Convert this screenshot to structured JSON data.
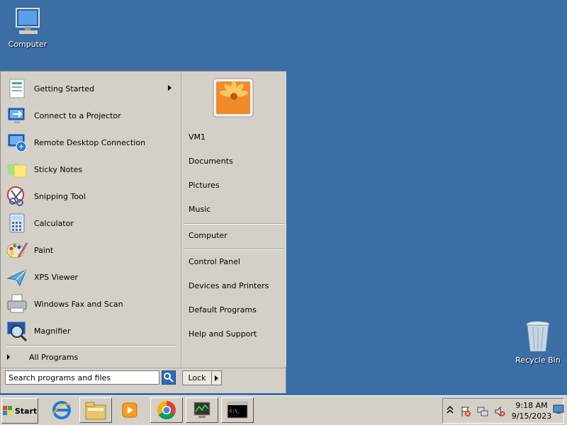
{
  "desktop": {
    "icons": [
      {
        "label": "Computer",
        "icon": "computer-icon"
      },
      {
        "label": "Recycle Bin",
        "icon": "recycle-bin-icon"
      }
    ]
  },
  "start_menu": {
    "programs": [
      {
        "label": "Getting Started",
        "icon": "getting-started-icon",
        "has_submenu": true
      },
      {
        "label": "Connect to a Projector",
        "icon": "projector-icon"
      },
      {
        "label": "Remote Desktop Connection",
        "icon": "remote-desktop-icon"
      },
      {
        "label": "Sticky Notes",
        "icon": "sticky-notes-icon"
      },
      {
        "label": "Snipping Tool",
        "icon": "snipping-tool-icon"
      },
      {
        "label": "Calculator",
        "icon": "calculator-icon"
      },
      {
        "label": "Paint",
        "icon": "paint-icon"
      },
      {
        "label": "XPS Viewer",
        "icon": "xps-viewer-icon"
      },
      {
        "label": "Windows Fax and Scan",
        "icon": "fax-scan-icon"
      },
      {
        "label": "Magnifier",
        "icon": "magnifier-icon"
      }
    ],
    "all_programs": "All Programs",
    "right_items": {
      "user": "VM1",
      "documents": "Documents",
      "pictures": "Pictures",
      "music": "Music",
      "computer": "Computer",
      "control_panel": "Control Panel",
      "devices": "Devices and Printers",
      "default_programs": "Default Programs",
      "help": "Help and Support"
    },
    "search_placeholder": "Search programs and files",
    "lock_label": "Lock"
  },
  "taskbar": {
    "start_label": "Start",
    "pinned": [
      "internet-explorer-icon",
      "file-explorer-icon",
      "media-player-icon",
      "chrome-icon",
      "task-manager-icon",
      "command-prompt-icon"
    ],
    "clock_time": "9:18 AM",
    "clock_date": "9/15/2023"
  },
  "colors": {
    "desktop": "#3a6ea5",
    "menu": "#d4d0c8"
  }
}
